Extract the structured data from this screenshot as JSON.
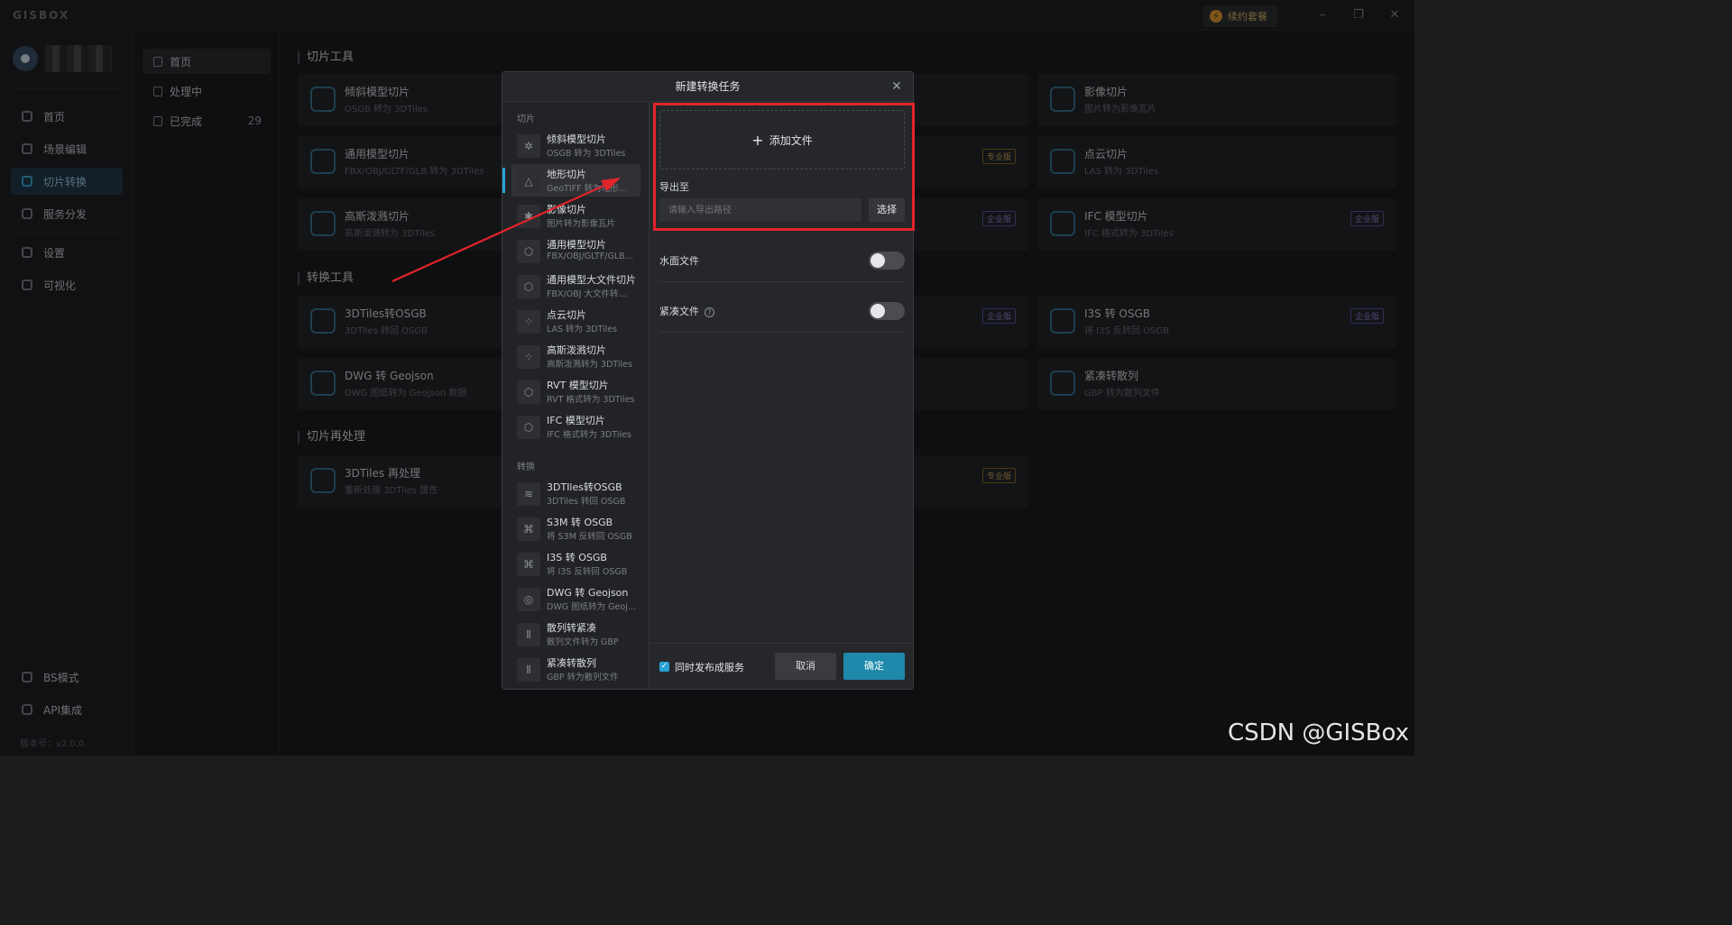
{
  "app": {
    "logo": "GISBOX",
    "renew_label": "续约套餐"
  },
  "window_controls": {
    "minimize": "–",
    "maximize": "❐",
    "close": "✕"
  },
  "sidebar": {
    "items": [
      {
        "label": "首页"
      },
      {
        "label": "场景编辑"
      },
      {
        "label": "切片转换"
      },
      {
        "label": "服务分发"
      },
      {
        "label": "设置"
      },
      {
        "label": "可视化"
      }
    ],
    "bottom_items": [
      {
        "label": "BS模式"
      },
      {
        "label": "API集成"
      }
    ],
    "version": "版本号：v2.0.0"
  },
  "subnav": {
    "items": [
      {
        "label": "首页",
        "count": ""
      },
      {
        "label": "处理中",
        "count": ""
      },
      {
        "label": "已完成",
        "count": "29"
      }
    ]
  },
  "main": {
    "sections": [
      {
        "title": "切片工具"
      },
      {
        "title": "转换工具"
      },
      {
        "title": "切片再处理"
      }
    ],
    "cards": [
      {
        "title": "倾斜模型切片",
        "sub": "OSGB 转为 3DTiles",
        "badge": ""
      },
      {
        "title": "影像切片",
        "sub": "图片转为影像瓦片",
        "badge": ""
      },
      {
        "title": "通用模型切片",
        "sub": "FBX/OBJ/GLTF/GLB 转为 3DTiles",
        "badge": ""
      },
      {
        "title": "",
        "sub": "",
        "badge": "专业版"
      },
      {
        "title": "点云切片",
        "sub": "LAS 转为 3DTiles",
        "badge": ""
      },
      {
        "title": "高斯泼溅切片",
        "sub": "高斯泼溅转为 3DTiles",
        "badge": ""
      },
      {
        "title": "",
        "sub": "",
        "badge": "企业版"
      },
      {
        "title": "IFC 模型切片",
        "sub": "IFC 格式转为 3DTiles",
        "badge": "企业版"
      },
      {
        "title": "3DTiles转OSGB",
        "sub": "3DTiles 转回 OSGB",
        "badge": ""
      },
      {
        "title": "",
        "sub": "",
        "badge": "企业版"
      },
      {
        "title": "I3S 转 OSGB",
        "sub": "将 I3S 反转回 OSGB",
        "badge": "企业版"
      },
      {
        "title": "DWG 转 Geojson",
        "sub": "DWG 图纸转为 Geojson 数据",
        "badge": ""
      },
      {
        "title": "",
        "sub": "",
        "badge": ""
      },
      {
        "title": "紧凑转散列",
        "sub": "GBP 转为散列文件",
        "badge": ""
      },
      {
        "title": "3DTiles 再处理",
        "sub": "重新处理 3DTiles 属性",
        "badge": ""
      },
      {
        "title": "",
        "sub": "",
        "badge": "专业版"
      }
    ]
  },
  "dialog": {
    "title": "新建转换任务",
    "close": "✕",
    "group_slice": "切片",
    "group_convert": "转换",
    "slice_items": [
      {
        "title": "倾斜模型切片",
        "sub": "OSGB 转为 3DTiles"
      },
      {
        "title": "地形切片",
        "sub": "GeoTIFF 转为地形…"
      },
      {
        "title": "影像切片",
        "sub": "图片转为影像瓦片"
      },
      {
        "title": "通用模型切片",
        "sub": "FBX/OBJ/GLTF/GLB…"
      },
      {
        "title": "通用模型大文件切片",
        "sub": "FBX/OBJ 大文件转…"
      },
      {
        "title": "点云切片",
        "sub": "LAS 转为 3DTiles"
      },
      {
        "title": "高斯泼溅切片",
        "sub": "高斯泼溅转为 3DTiles"
      },
      {
        "title": "RVT 模型切片",
        "sub": "RVT 格式转为 3DTiles"
      },
      {
        "title": "IFC 模型切片",
        "sub": "IFC 格式转为 3DTiles"
      }
    ],
    "convert_items": [
      {
        "title": "3DTIles转OSGB",
        "sub": "3DTiles 转回 OSGB"
      },
      {
        "title": "S3M 转 OSGB",
        "sub": "将 S3M 反转回 OSGB"
      },
      {
        "title": "I3S 转 OSGB",
        "sub": "将 I3S 反转回 OSGB"
      },
      {
        "title": "DWG 转 Geojson",
        "sub": "DWG 图纸转为 Geoj…"
      },
      {
        "title": "散列转紧凑",
        "sub": "散列文件转为 GBP"
      },
      {
        "title": "紧凑转散列",
        "sub": "GBP 转为散列文件"
      }
    ],
    "add_file": "添加文件",
    "export_label": "导出至",
    "export_placeholder": "请输入导出路径",
    "choose_button": "选择",
    "water_label": "水面文件",
    "compact_label": "紧凑文件",
    "publish_label": "同时发布成服务",
    "cancel": "取消",
    "confirm": "确定"
  },
  "watermark": "CSDN @GISBox",
  "colors": {
    "accent": "#1e89ab",
    "highlight_box": "#e2242b",
    "arrow": "#e2242b"
  }
}
